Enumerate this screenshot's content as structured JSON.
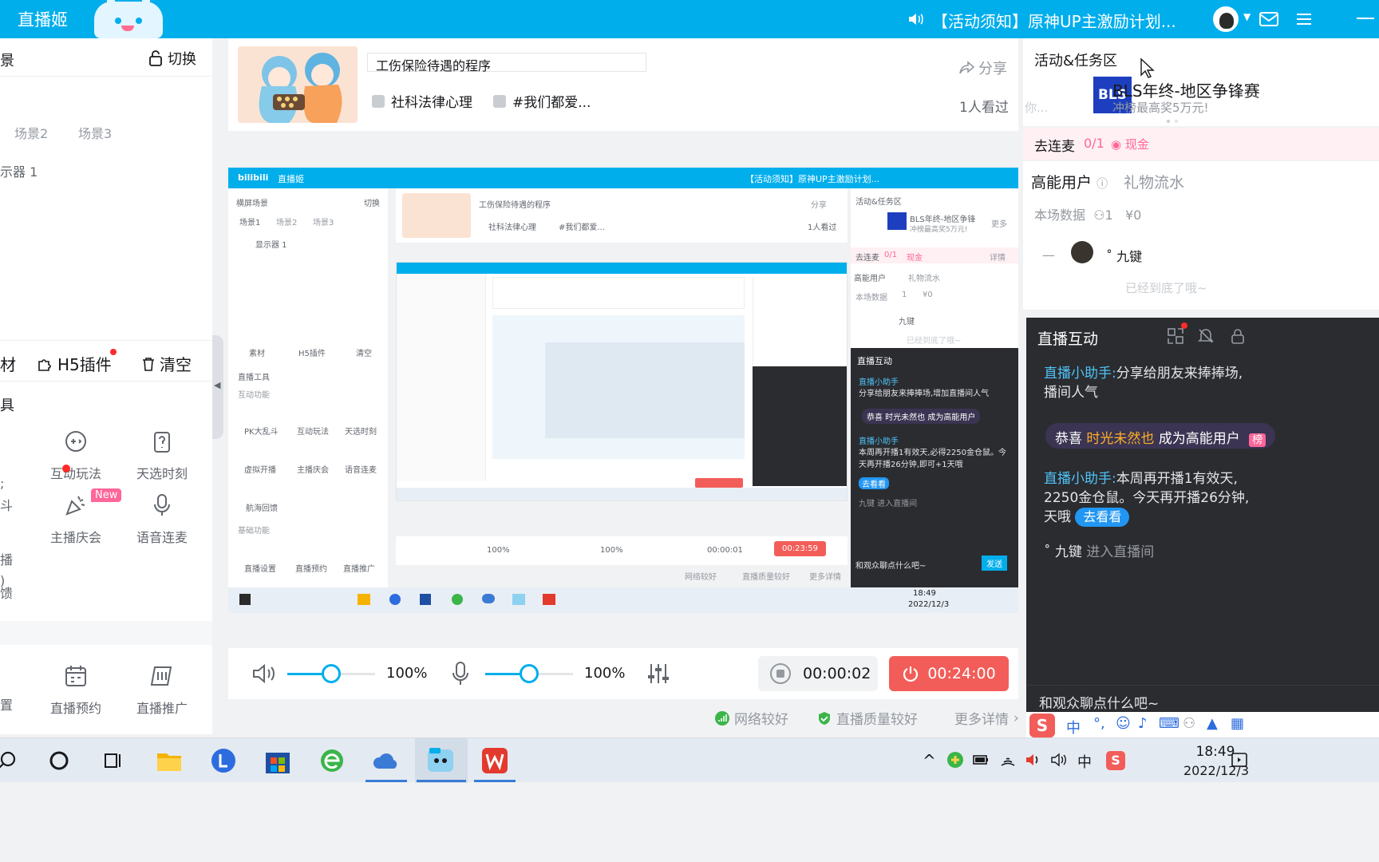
{
  "topbar": {
    "app_title": "直播姬",
    "notice": "【活动须知】原神UP主激励计划...",
    "icons": [
      "speaker-icon",
      "avatar",
      "mail-icon",
      "menu-icon",
      "minimize-icon"
    ]
  },
  "left": {
    "scene_title": "景",
    "switch_label": "切换",
    "tabs": [
      "场景2",
      "场景3"
    ],
    "display_item": "示器 1",
    "actions": {
      "materials_frag": "材",
      "h5_plugin": "H5插件",
      "clear": "清空"
    },
    "tools_title": "具",
    "tools": [
      {
        "label": "互动玩法"
      },
      {
        "label": "天选时刻"
      },
      {
        "label": "主播庆会",
        "badge": "New"
      },
      {
        "label": "语音连麦"
      },
      {
        "label": "直播预约"
      },
      {
        "label": "直播推广"
      }
    ],
    "fragments": [
      "斗",
      "播",
      "馈",
      "置"
    ]
  },
  "room": {
    "title": "工伤保险待遇的程序",
    "tag1": "社科法律心理",
    "tag2": "#我们都爱...",
    "share": "分享",
    "viewers": "1人看过"
  },
  "preview": {
    "topbar_title": "直播姬",
    "notice": "【活动须知】原神UP主激励计划...",
    "scene": "横屏场景",
    "switch": "切换",
    "tabs": [
      "场景1",
      "场景2",
      "场景3"
    ],
    "display": "显示器 1",
    "actions": [
      "素材",
      "H5插件",
      "清空"
    ],
    "tools_title": "直播工具",
    "interactive": "互动功能",
    "tool_labels": [
      "PK大乱斗",
      "互动玩法",
      "天选时刻",
      "虚拟开播",
      "主播庆会",
      "语音连麦",
      "航海回馈"
    ],
    "basic": "基础功能",
    "basic_labels": [
      "直播设置",
      "直播预约",
      "直播推广"
    ],
    "room_title": "工伤保险待遇的程序",
    "tag1": "社科法律心理",
    "tag2": "#我们都爱...",
    "share": "分享",
    "viewers": "1人看过",
    "right_title": "活动&任务区",
    "bls_name": "BLS年终-地区争锋",
    "bls_sub": "冲榜最高奖5万元!",
    "more": "更多",
    "mic": "去连麦",
    "mic_count": "0/1",
    "cash": "现金",
    "detail": "详情",
    "high_users": "高能用户",
    "gift_flow": "礼物流水",
    "stats": "本场数据",
    "stats_count": "1",
    "stats_money": "¥0",
    "user": "九键",
    "end": "已经到底了哦~",
    "interact_title": "直播互动",
    "msg1_who": "直播小助手",
    "msg1": "分享给朋友来捧捧场,增加直播间人气",
    "msg2": "恭喜 时光未然也 成为高能用户",
    "msg3_who": "直播小助手",
    "msg3": "本周再开播1有效天,必得2250金仓鼠。今天再开播26分钟,即可+1天哦",
    "go_see": "去看看",
    "msg4": "九键 进入直播间",
    "chat_placeholder": "和观众聊点什么吧~",
    "send": "发送",
    "vol1": "100%",
    "vol2": "100%",
    "timer": "00:00:01",
    "live_time": "00:23:59",
    "net": "网络较好",
    "quality": "直播质量较好",
    "more_details": "更多详情",
    "clock_time": "18:49",
    "clock_date": "2022/12/3"
  },
  "controls": {
    "speaker_volume": "100%",
    "mic_volume": "100%",
    "speaker_level": 0.5,
    "mic_level": 0.5,
    "timer": "00:00:02",
    "live_time": "00:24:00"
  },
  "status": {
    "network": "网络较好",
    "quality": "直播质量较好",
    "more": "更多详情"
  },
  "right": {
    "activity_title": "活动&任务区",
    "bls_logo": "BLS",
    "bls_name": "BLS年终-地区争锋赛",
    "bls_sub": "冲榜最高奖5万元!",
    "frag": "你...",
    "mic_label": "去连麦",
    "mic_count": "0/1",
    "cash": "现金",
    "high_users": "高能用户",
    "gift_flow": "礼物流水",
    "stats_label": "本场数据",
    "stats_users": "1",
    "stats_money": "¥0",
    "dash": "—",
    "user_name": "˚ 九键",
    "end_text": "已经到底了哦~"
  },
  "interact": {
    "title": "直播互动",
    "msg1_who": "直播小助手:",
    "msg1_text": "分享给朋友来捧捧场,",
    "msg1_text2": "播间人气",
    "congrats_prefix": "恭喜",
    "congrats_user": "时光未然也",
    "congrats_suffix": "成为高能用户",
    "congrats_badge": "榜",
    "msg3_who": "直播小助手:",
    "msg3_text": "本周再开播1有效天,",
    "msg3_text2": "2250金仓鼠。今天再开播26分钟,",
    "msg3_text3": "天哦",
    "go_see": "去看看",
    "enter_user": "˚ 九键",
    "enter_text": "进入直播间",
    "chat_placeholder": "和观众聊点什么吧~"
  },
  "taskbar": {
    "apps": [
      "search-icon",
      "cortana-icon",
      "task-view-icon",
      "file-explorer-icon",
      "l-app-icon",
      "store-icon",
      "ie-icon",
      "cloud-icon",
      "live-app-icon",
      "wps-icon"
    ],
    "time": "18:49",
    "date": "2022/12/3",
    "ime_lang": "中"
  },
  "colors": {
    "accent": "#00aeec",
    "live_red": "#f25d59",
    "pink": "#ff6699",
    "dark_panel": "#2b2c30"
  }
}
